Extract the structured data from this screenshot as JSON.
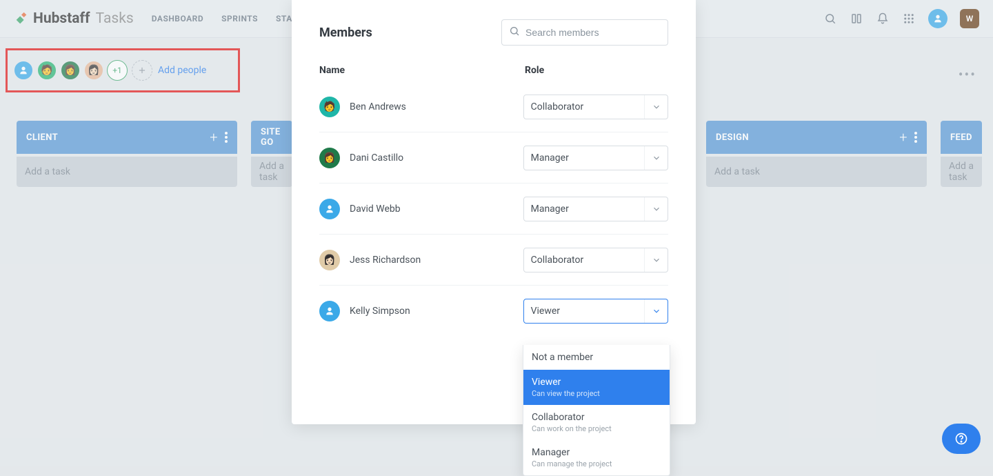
{
  "brand": {
    "logo_color_a": "#3ba76a",
    "logo_color_b": "#e86c3b",
    "name": "Hubstaff",
    "sub": "Tasks"
  },
  "nav": {
    "tabs": [
      "DASHBOARD",
      "SPRINTS",
      "STAND-U"
    ]
  },
  "topbar": {
    "user_initial": "W"
  },
  "people_row": {
    "extra_count": "+1",
    "add_label": "Add people"
  },
  "board": {
    "add_task_placeholder": "Add a task",
    "columns": [
      {
        "title": "CLIENT"
      },
      {
        "title": "SITE GO"
      },
      {
        "title": ""
      },
      {
        "title": "DESIGN"
      },
      {
        "title": "FEED"
      }
    ]
  },
  "modal": {
    "title": "Members",
    "search_placeholder": "Search members",
    "columns": {
      "name": "Name",
      "role": "Role"
    },
    "members": [
      {
        "name": "Ben Andrews",
        "role": "Collaborator",
        "avatar_kind": "photo",
        "avatar_bg": "bg-teal"
      },
      {
        "name": "Dani Castillo",
        "role": "Manager",
        "avatar_kind": "photo",
        "avatar_bg": "bg-darkgreen"
      },
      {
        "name": "David Webb",
        "role": "Manager",
        "avatar_kind": "icon",
        "avatar_bg": "bg-blue2"
      },
      {
        "name": "Jess Richardson",
        "role": "Collaborator",
        "avatar_kind": "photo",
        "avatar_bg": "bg-beige"
      },
      {
        "name": "Kelly Simpson",
        "role": "Viewer",
        "avatar_kind": "icon",
        "avatar_bg": "bg-blue2",
        "open": true
      }
    ],
    "role_options": [
      {
        "label": "Not a member",
        "desc": ""
      },
      {
        "label": "Viewer",
        "desc": "Can view the project",
        "selected": true
      },
      {
        "label": "Collaborator",
        "desc": "Can work on the project"
      },
      {
        "label": "Manager",
        "desc": "Can manage the project"
      }
    ]
  }
}
